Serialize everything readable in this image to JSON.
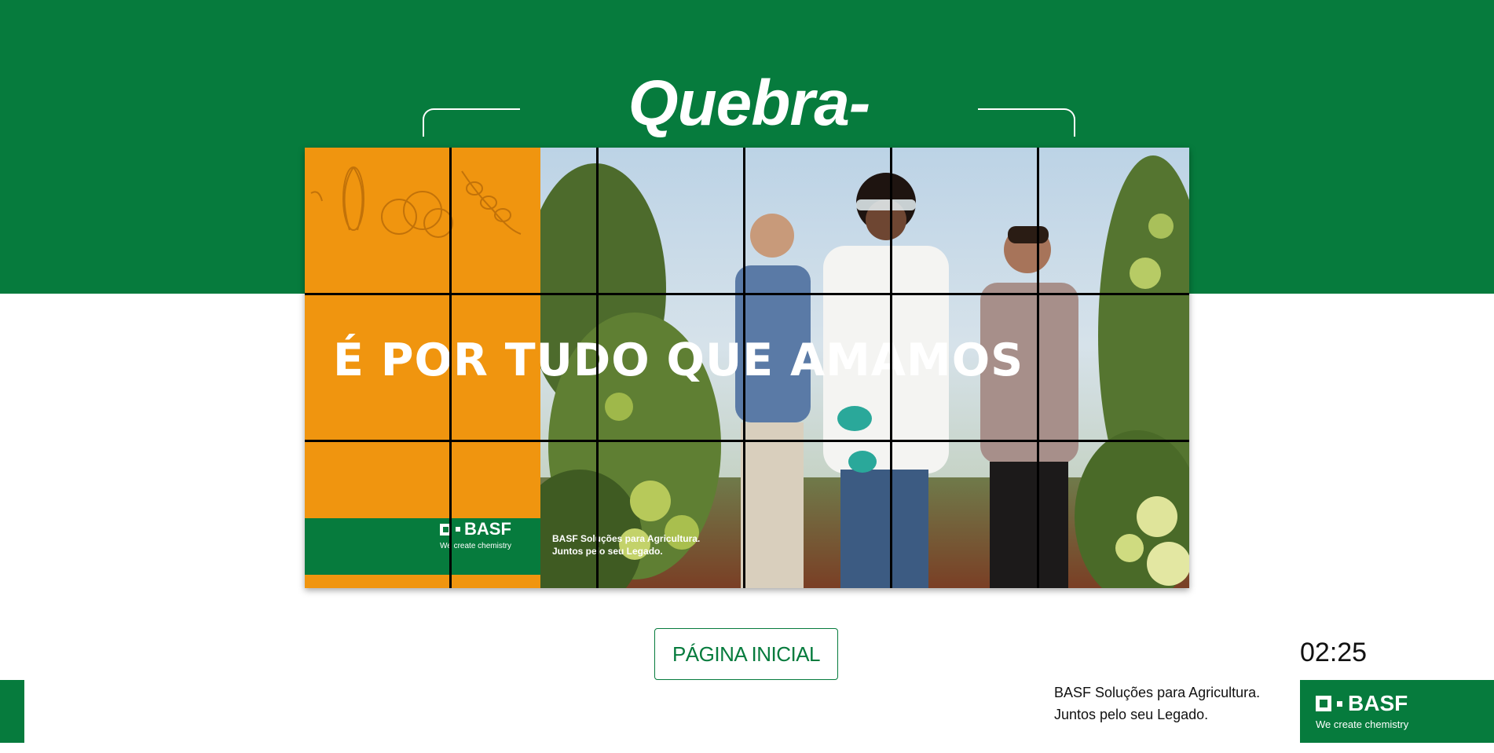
{
  "title": "Quebra-Cabeça",
  "puzzle": {
    "headline": "É POR TUDO QUE AMAMOS",
    "brand": "BASF",
    "brand_tagline": "We create chemistry",
    "tagline_line1": "BASF Soluções para Agricultura.",
    "tagline_line2": "Juntos pelo seu Legado.",
    "grid": {
      "columns": 6,
      "rows": 3
    }
  },
  "home_button": {
    "label": "PÁGINA INICIAL"
  },
  "timer": "02:25",
  "footer": {
    "tagline_line1": "BASF Soluções para Agricultura.",
    "tagline_line2": "Juntos pelo seu Legado.",
    "brand": "BASF",
    "brand_tagline": "We create chemistry"
  },
  "colors": {
    "brand_green": "#067b3d",
    "orange": "#f0950f",
    "white": "#ffffff"
  }
}
